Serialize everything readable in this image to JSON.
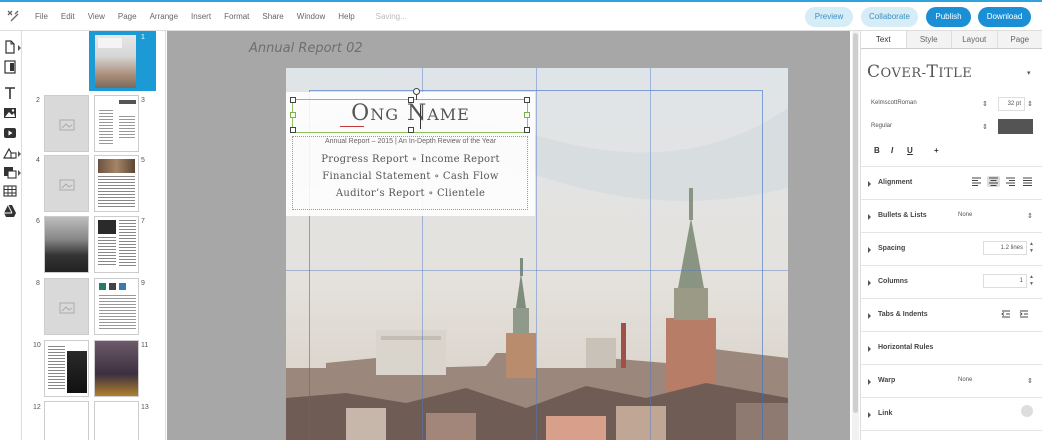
{
  "menubar": {
    "items": [
      "File",
      "Edit",
      "View",
      "Page",
      "Arrange",
      "Insert",
      "Format",
      "Share",
      "Window",
      "Help"
    ],
    "status": "Saving...",
    "buttons": {
      "preview": "Preview",
      "collaborate": "Collaborate",
      "publish": "Publish",
      "download": "Download"
    }
  },
  "colors": {
    "accent": "#1b8fd6",
    "accent_light": "#d6ecf7",
    "selection_green": "#8fc25a",
    "text_swatch": "#545454"
  },
  "tools": [
    "page-tool-icon",
    "page-layout-icon",
    "text-tool-icon",
    "image-tool-icon",
    "video-tool-icon",
    "shape-tool-icon",
    "fill-tool-icon",
    "table-tool-icon",
    "drive-icon"
  ],
  "thumbnails": {
    "page_numbers": [
      "1",
      "2",
      "3",
      "4",
      "5",
      "6",
      "7",
      "8",
      "9",
      "10",
      "11",
      "12",
      "13"
    ]
  },
  "canvas": {
    "document_title": "Annual Report 02",
    "cover": {
      "name_part1_big": "O",
      "name_part1_small": "NG",
      "name_part2_big": "N",
      "name_part2_small": "AME",
      "subtitle": "Annual Report – 2015 | An In-Depth Review of the Year",
      "toc_line1": "Progress Report  ∘  Income Report",
      "toc_line2": "Financial Statement  ∘  Cash Flow",
      "toc_line3": "Auditor’s Report  ∘  Clientele"
    }
  },
  "properties": {
    "tabs": [
      "Text",
      "Style",
      "Layout",
      "Page"
    ],
    "style_name_big1": "C",
    "style_name_small1": "OVER-",
    "style_name_big2": "T",
    "style_name_small2": "ITLE",
    "font": "KelmscottRoman",
    "font_size": "32 pt",
    "font_weight": "Regular",
    "format_buttons": [
      "B",
      "I",
      "U",
      "+"
    ],
    "sections": {
      "alignment": "Alignment",
      "bullets": "Bullets & Lists",
      "bullets_value": "None",
      "spacing": "Spacing",
      "spacing_value": "1.2 lines",
      "columns": "Columns",
      "columns_value": "1",
      "tabs": "Tabs & Indents",
      "rules": "Horizontal Rules",
      "warp": "Warp",
      "warp_value": "None",
      "link": "Link"
    }
  }
}
